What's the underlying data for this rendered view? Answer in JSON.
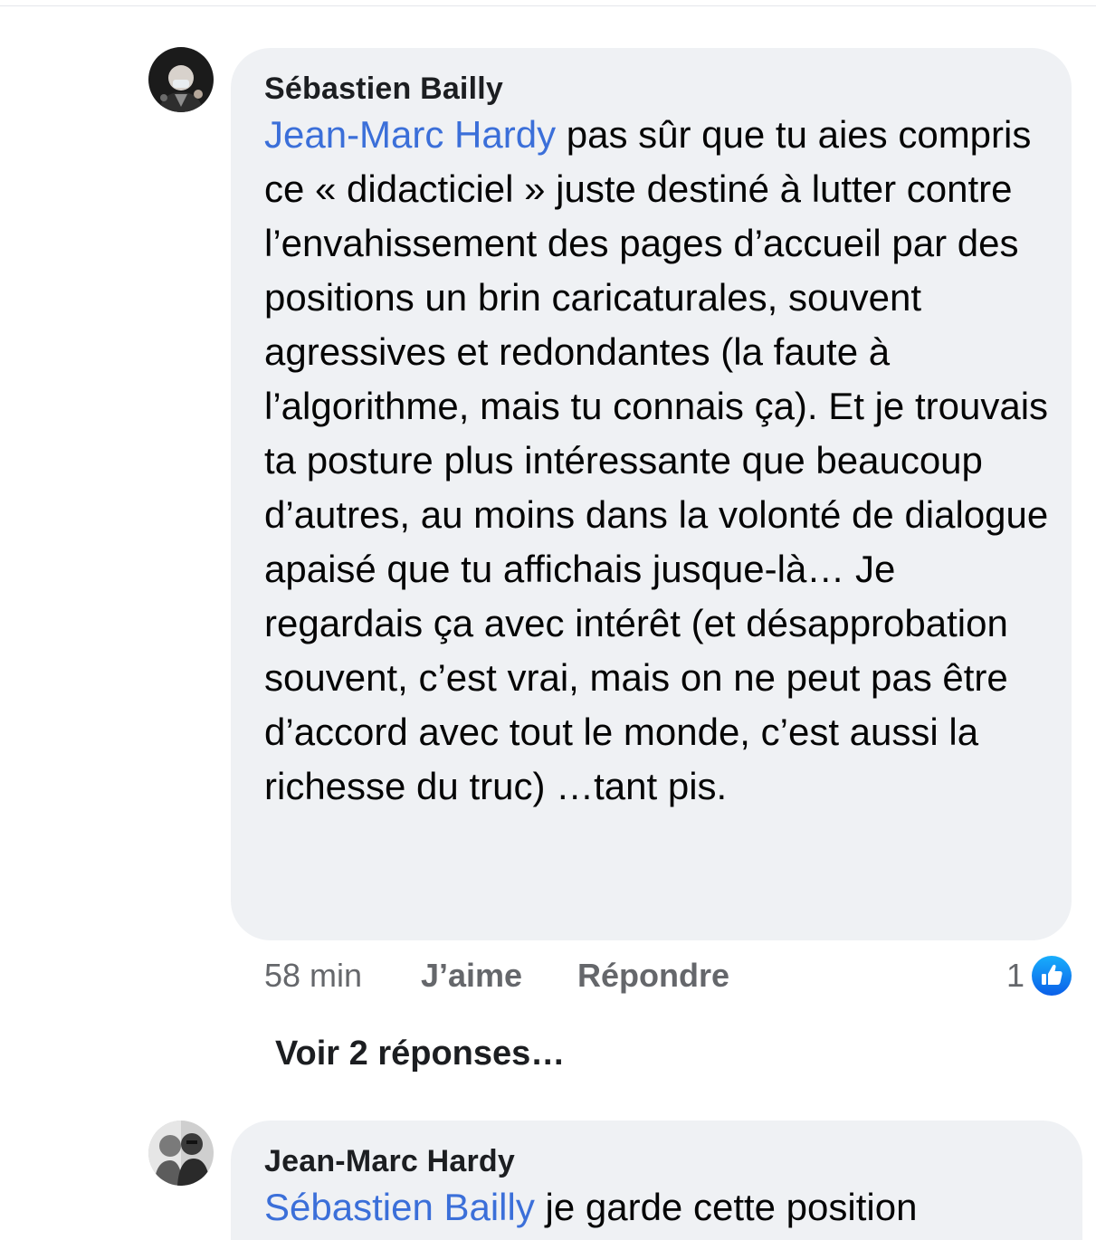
{
  "comment": {
    "author": "Sébastien Bailly",
    "mention": "Jean-Marc Hardy",
    "text": " pas sûr que tu aies compris ce « didacticiel » juste destiné à lutter contre l’envahissement des pages d’accueil par des positions un brin caricaturales, souvent agressives et redondantes (la faute à l’algorithme, mais tu connais ça). Et je trouvais ta posture plus intéressante que beaucoup d’autres, au moins dans la volonté de dialogue apaisé que tu affichais jusque-là… Je regardais ça avec intérêt (et désapprobation souvent, c’est vrai, mais on ne peut pas être d’accord avec tout le monde, c’est aussi la richesse du truc) …tant pis.",
    "time": "58 min",
    "like_label": "J’aime",
    "reply_label": "Répondre",
    "reaction_count": "1",
    "reaction_icon": "thumbs-up-icon",
    "reaction_color": "#1877f2"
  },
  "see_replies": "Voir 2 réponses…",
  "reply": {
    "author": "Jean-Marc Hardy",
    "mention": "Sébastien Bailly",
    "text": " je garde cette position"
  },
  "colors": {
    "bubble": "#eff1f4",
    "mention": "#3b6fd9",
    "meta": "#65676b"
  }
}
